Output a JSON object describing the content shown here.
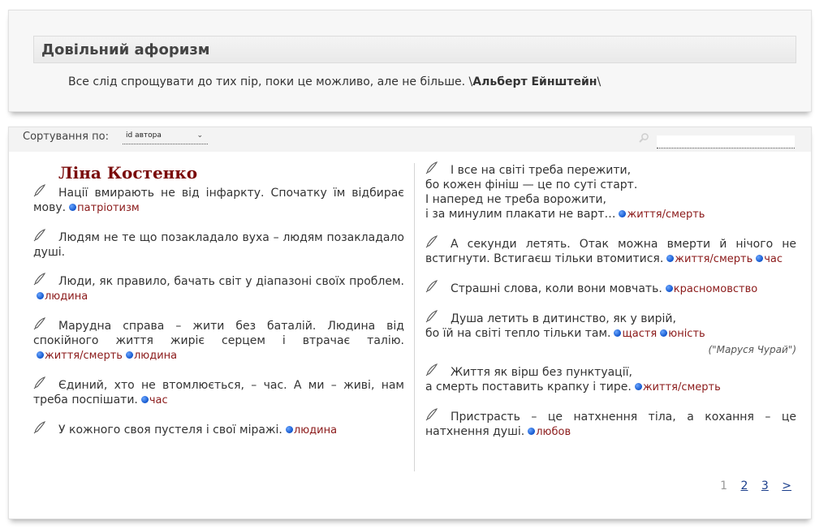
{
  "random_aphorism": {
    "heading": "Довільний афоризм",
    "text": "Все слід спрощувати до тих пір, поки це можливо, але не більше. \\",
    "author": "Альберт Ейнштейн",
    "suffix": "\\"
  },
  "sort": {
    "label": "Сортування по:",
    "selected": "id автора",
    "arrow": "⌄"
  },
  "author": "Ліна Костенко",
  "quotes_left": [
    {
      "text": "Нації вмирають не від інфаркту. Спочатку їм відбирає мову.",
      "tags": [
        "патріотизм"
      ]
    },
    {
      "text": "Людям не те що позакладало вуха – людям позакладало душі.",
      "tags": []
    },
    {
      "text": "Люди, як правило, бачать світ у діапазоні своїх проблем.",
      "tags": [
        "людина"
      ]
    },
    {
      "text": "Марудна справа – жити без баталій. Людина від спокійного життя жиріє серцем і втрачає талію.",
      "tags": [
        "життя/смерть",
        "людина"
      ]
    },
    {
      "text": "Єдиний, хто не втомлюється, – час. А ми – живі, нам треба поспішати.",
      "tags": [
        "час"
      ]
    },
    {
      "text": "У кожного своя пустеля і свої міражі.",
      "tags": [
        "людина"
      ]
    }
  ],
  "quotes_right": [
    {
      "text": "І все на світі треба пережити,\nбо кожен фініш — це по суті старт.\nІ наперед не треба ворожити,\nі за минулим плакати не варт…",
      "tags": [
        "життя/смерть"
      ]
    },
    {
      "text": "А секунди летять. Отак можна вмерти й нічого не встигнути. Встигаєш тільки втомитися.",
      "tags": [
        "життя/смерть",
        "час"
      ]
    },
    {
      "text": "Страшні слова, коли вони мовчать.",
      "tags": [
        "красномовство"
      ]
    },
    {
      "text": "Душа летить в дитинство, як у вирій,\nбо їй на світі тепло тільки там.",
      "tags": [
        "щастя",
        "юність"
      ],
      "source": "(\"Маруся Чурай\")"
    },
    {
      "text": "Життя як вірш без пунктуації,\nа смерть поставить крапку і тире.",
      "tags": [
        "життя/смерть"
      ]
    },
    {
      "text": "Пристрасть – це натхнення тіла, а кохання – це натхнення душі.",
      "tags": [
        "любов"
      ]
    }
  ],
  "pagination": {
    "pages": [
      "1",
      "2",
      "3",
      ">"
    ],
    "current": "1"
  },
  "colors": {
    "author": "#7a0a0a",
    "tag": "#8b1a1a",
    "tag_dot": "#1155cc",
    "link": "#1a3e8c"
  },
  "icons": {
    "quote_marker": "pen-icon",
    "tag_marker": "dot-icon",
    "search": "search-icon"
  }
}
